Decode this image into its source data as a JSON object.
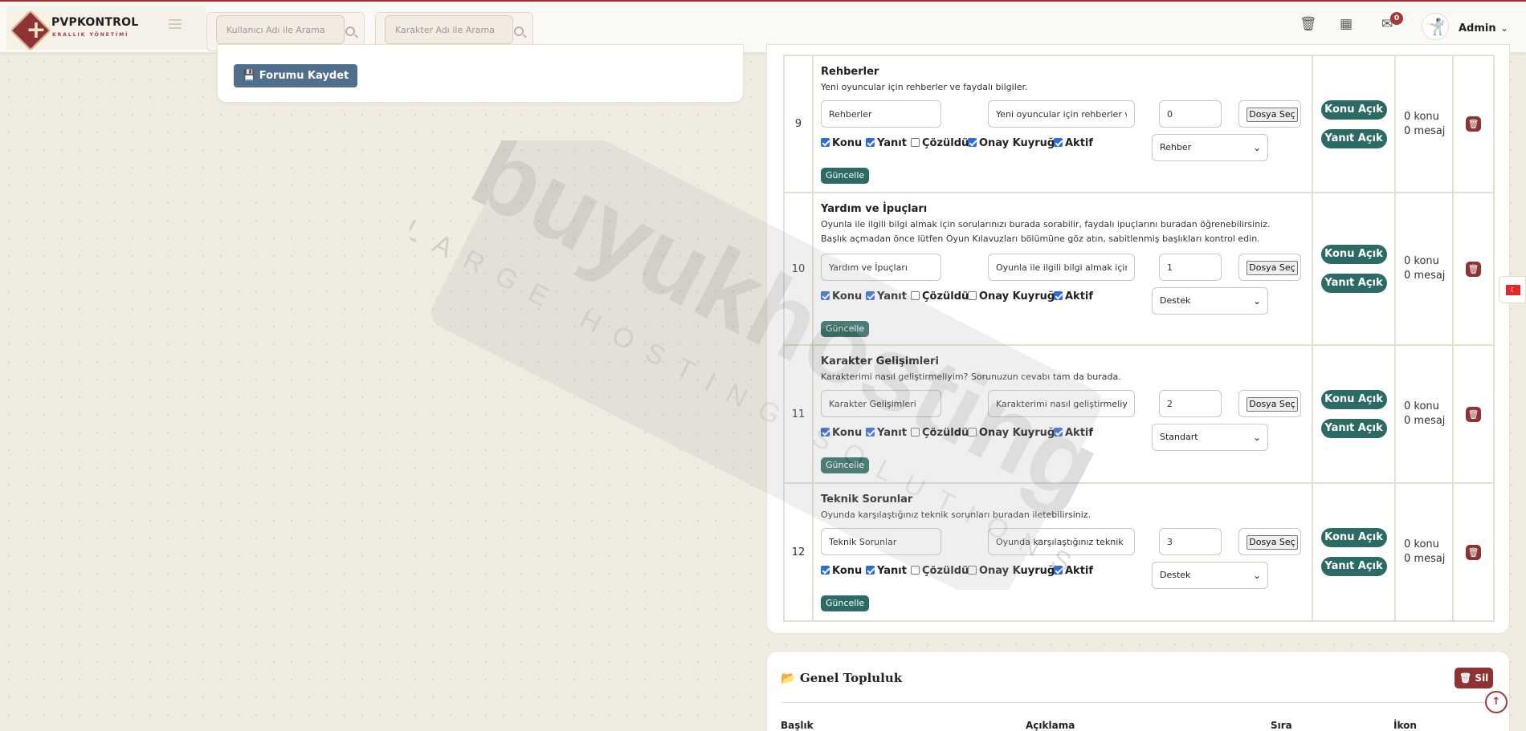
{
  "brand": {
    "name": "PVPKONTROL",
    "subtitle": "KRALLIK YÖNETİMİ"
  },
  "header": {
    "user_search_placeholder": "Kullanıcı Adı ile Arama",
    "char_search_placeholder": "Karakter Adı ile Arama",
    "notification_count": "0",
    "admin_name": "Admin"
  },
  "left_card": {
    "save_button": "Forumu Kaydet"
  },
  "checkbox_labels": {
    "topic": "Konu",
    "reply": "Yanıt",
    "solved": "Çözüldü",
    "approval": "Onay Kuyruğu",
    "active": "Aktif"
  },
  "file_button": "Dosya Seç",
  "update_button": "Güncelle",
  "topic_open_button": "Konu Açık",
  "reply_open_button": "Yanıt Açık",
  "forums": [
    {
      "num": "9",
      "title": "Rehberler",
      "desc": "Yeni oyuncular için rehberler ve faydalı bilgiler.",
      "name_value": "Rehberler",
      "desc_value": "Yeni oyuncular için rehberler ve faydalı bilgiler.",
      "order": "0",
      "type": "Rehber",
      "topics": "0 konu",
      "messages": "0 mesaj"
    },
    {
      "num": "10",
      "title": "Yardım ve İpuçları",
      "desc": "Oyunla ile ilgili bilgi almak için sorularınızı burada sorabilir, faydalı ipuçlarını buradan öğrenebilirsiniz. Başlık açmadan önce lütfen Oyun Kılavuzları bölümüne göz atın, sabitlenmiş başlıkları kontrol edin.",
      "name_value": "Yardım ve İpuçları",
      "desc_value": "Oyunla ile ilgili bilgi almak için sorularınızı burada sorabilir",
      "order": "1",
      "type": "Destek",
      "topics": "0 konu",
      "messages": "0 mesaj"
    },
    {
      "num": "11",
      "title": "Karakter Gelişimleri",
      "desc": "Karakterimi nasıl geliştirmeliyim? Sorunuzun cevabı tam da burada.",
      "name_value": "Karakter Gelişimleri",
      "desc_value": "Karakterimi nasıl geliştirmeliyim? Sorunuzun cevabı tam da burada.",
      "order": "2",
      "type": "Standart",
      "topics": "0 konu",
      "messages": "0 mesaj"
    },
    {
      "num": "12",
      "title": "Teknik Sorunlar",
      "desc": "Oyunda karşılaştığınız teknik sorunları buradan iletebilirsiniz.",
      "name_value": "Teknik Sorunlar",
      "desc_value": "Oyunda karşılaştığınız teknik sorunları buradan iletebilirsiniz.",
      "order": "3",
      "type": "Destek",
      "topics": "0 konu",
      "messages": "0 mesaj"
    }
  ],
  "checkbox_states": [
    {
      "topic": true,
      "reply": true,
      "solved": false,
      "approval": true,
      "active": true
    },
    {
      "topic": true,
      "reply": true,
      "solved": false,
      "approval": false,
      "active": true
    },
    {
      "topic": true,
      "reply": true,
      "solved": false,
      "approval": false,
      "active": true
    },
    {
      "topic": true,
      "reply": true,
      "solved": false,
      "approval": false,
      "active": true
    }
  ],
  "bottom_card": {
    "title": "Genel Topluluk",
    "delete_button": "Sil",
    "columns": [
      "Başlık",
      "Açıklama",
      "Sıra",
      "İkon"
    ]
  },
  "watermark": {
    "brand": "buyukhosting",
    "tagline": "LARGE HOSTING SOLUTIONS"
  },
  "icons": {
    "trash": "trash-icon",
    "calendar": "calendar-icon",
    "mail": "mail-icon",
    "save": "floppy-icon",
    "folder": "folder-open-icon",
    "flag": "turkey-flag-icon",
    "up": "arrow-up-icon"
  },
  "colors": {
    "brand_red": "#8e3434",
    "teal": "#2c6b65",
    "slate_blue": "#4f6f8c",
    "danger": "#8e3333"
  }
}
